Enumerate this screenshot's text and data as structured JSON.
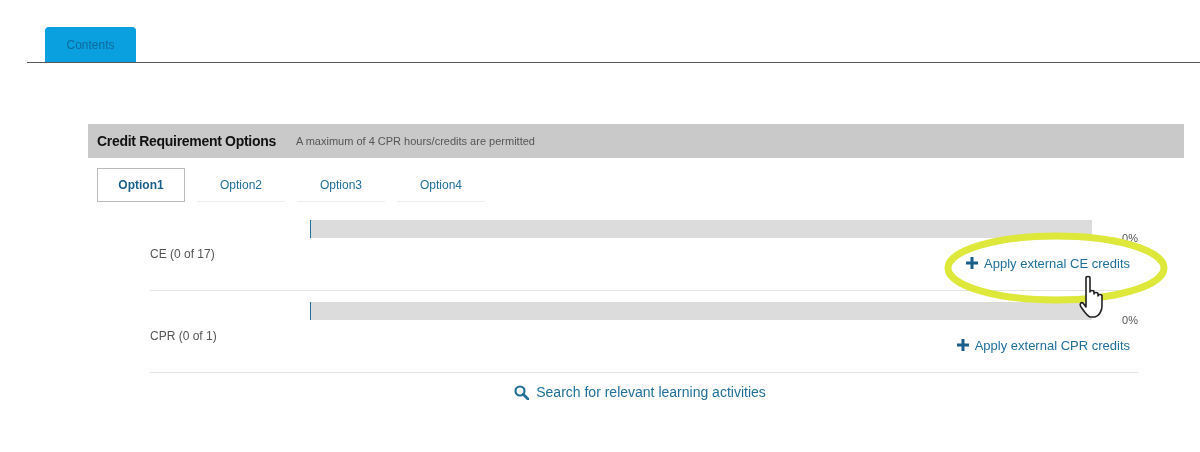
{
  "top_tabs": [
    {
      "label": "Contents",
      "selected": true
    }
  ],
  "panel": {
    "title": "Credit Requirement Options",
    "note": "A maximum of 4 CPR hours/credits are permitted"
  },
  "option_tabs": [
    {
      "label": "Option1",
      "selected": true
    },
    {
      "label": "Option2",
      "selected": false
    },
    {
      "label": "Option3",
      "selected": false
    },
    {
      "label": "Option4",
      "selected": false
    }
  ],
  "requirements": [
    {
      "label": "CE (0 of 17)",
      "level": 0,
      "percent": "0%",
      "action": "Apply external CE credits"
    },
    {
      "label": "CPR (0 of 1)",
      "level": 0,
      "percent": "0%",
      "action": "Apply external CPR credits"
    }
  ],
  "search_link": "Search for relevant learning activities"
}
